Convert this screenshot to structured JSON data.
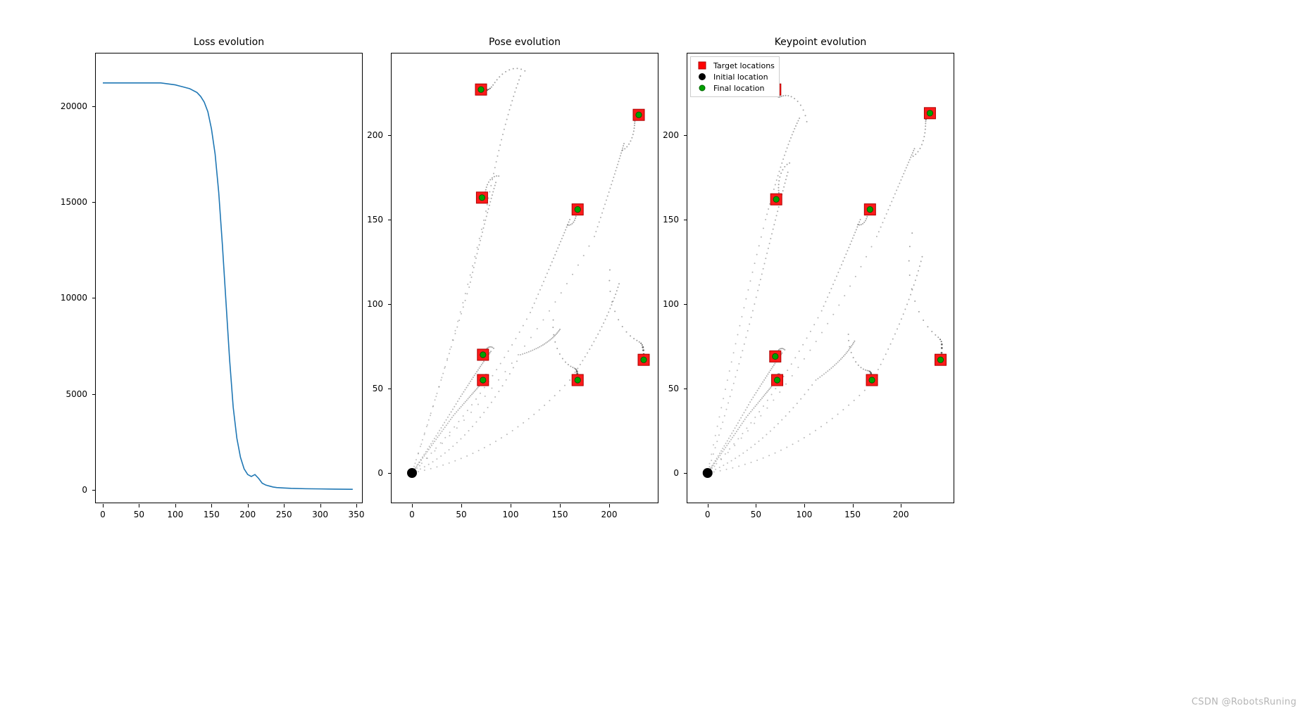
{
  "watermark": "CSDN @RobotsRuning",
  "legend": {
    "target": "Target locations",
    "initial": "Initial location",
    "final": "Final location"
  },
  "chart_data": [
    {
      "type": "line",
      "title": "Loss evolution",
      "xlabel": "",
      "ylabel": "",
      "xlim": [
        0,
        350
      ],
      "ylim": [
        0,
        22000
      ],
      "xticks": [
        0,
        50,
        100,
        150,
        200,
        250,
        300,
        350
      ],
      "yticks": [
        0,
        5000,
        10000,
        15000,
        20000
      ],
      "series": [
        {
          "name": "loss",
          "color": "#1f77b4",
          "x": [
            0,
            10,
            20,
            30,
            40,
            50,
            60,
            70,
            80,
            90,
            100,
            110,
            120,
            130,
            135,
            140,
            145,
            150,
            155,
            160,
            165,
            170,
            175,
            180,
            185,
            190,
            195,
            200,
            205,
            210,
            215,
            220,
            225,
            230,
            235,
            240,
            250,
            260,
            280,
            300,
            320,
            345
          ],
          "y": [
            21200,
            21200,
            21200,
            21200,
            21200,
            21200,
            21200,
            21200,
            21200,
            21150,
            21100,
            21000,
            20900,
            20700,
            20500,
            20200,
            19700,
            18800,
            17500,
            15500,
            12800,
            9800,
            6800,
            4300,
            2700,
            1700,
            1100,
            800,
            700,
            800,
            600,
            350,
            250,
            200,
            150,
            120,
            100,
            80,
            60,
            50,
            40,
            30
          ]
        }
      ]
    },
    {
      "type": "scatter",
      "title": "Pose evolution",
      "xlabel": "",
      "ylabel": "",
      "xlim": [
        -10,
        240
      ],
      "ylim": [
        -10,
        240
      ],
      "xticks": [
        0,
        50,
        100,
        150,
        200
      ],
      "yticks": [
        0,
        50,
        100,
        150,
        200
      ],
      "targets": [
        [
          70,
          227
        ],
        [
          230,
          212
        ],
        [
          71,
          163
        ],
        [
          168,
          156
        ],
        [
          72,
          70
        ],
        [
          72,
          55
        ],
        [
          168,
          55
        ],
        [
          235,
          67
        ]
      ],
      "initial": [
        [
          0,
          0
        ]
      ],
      "finals": [
        [
          70,
          227
        ],
        [
          230,
          212
        ],
        [
          71,
          163
        ],
        [
          168,
          156
        ],
        [
          72,
          70
        ],
        [
          72,
          55
        ],
        [
          168,
          55
        ],
        [
          235,
          67
        ]
      ],
      "trails": [
        {
          "ctrl": [
            45,
            80
          ],
          "mid": [
            75,
            155
          ],
          "swing": [
            110,
            235
          ],
          "swingR": 20,
          "end": [
            70,
            227
          ]
        },
        {
          "ctrl": [
            110,
            60
          ],
          "mid": [
            185,
            140
          ],
          "swing": [
            215,
            195
          ],
          "swingR": 14,
          "end": [
            230,
            212
          ]
        },
        {
          "ctrl": [
            30,
            55
          ],
          "mid": [
            58,
            110
          ],
          "swing": [
            85,
            172
          ],
          "swingR": 15,
          "end": [
            71,
            163
          ]
        },
        {
          "ctrl": [
            70,
            40
          ],
          "mid": [
            120,
            95
          ],
          "swing": [
            160,
            150
          ],
          "swingR": 12,
          "end": [
            168,
            156
          ]
        },
        {
          "ctrl": [
            25,
            22
          ],
          "mid": [
            48,
            44
          ],
          "swing": [
            80,
            72
          ],
          "swingR": 10,
          "end": [
            72,
            70
          ]
        },
        {
          "ctrl": [
            22,
            18
          ],
          "mid": [
            42,
            34
          ],
          "swing": [
            75,
            56
          ],
          "swingR": 8,
          "end": [
            72,
            55
          ]
        },
        {
          "ctrl": [
            60,
            15
          ],
          "mid": [
            110,
            70
          ],
          "swing": [
            150,
            85
          ],
          "swingR": 28,
          "end": [
            168,
            55
          ]
        },
        {
          "ctrl": [
            90,
            10
          ],
          "mid": [
            160,
            55
          ],
          "swing": [
            210,
            112
          ],
          "swingR": 40,
          "end": [
            235,
            67
          ]
        }
      ]
    },
    {
      "type": "scatter",
      "title": "Keypoint evolution",
      "xlabel": "",
      "ylabel": "",
      "xlim": [
        -10,
        245
      ],
      "ylim": [
        -10,
        240
      ],
      "xticks": [
        0,
        50,
        100,
        150,
        200
      ],
      "yticks": [
        0,
        50,
        100,
        150,
        200
      ],
      "legend": true,
      "targets": [
        [
          70,
          227
        ],
        [
          230,
          213
        ],
        [
          71,
          162
        ],
        [
          168,
          156
        ],
        [
          70,
          69
        ],
        [
          72,
          55
        ],
        [
          170,
          55
        ],
        [
          241,
          67
        ]
      ],
      "initial": [
        [
          0,
          0
        ]
      ],
      "finals": [
        [
          70,
          227
        ],
        [
          230,
          213
        ],
        [
          71,
          162
        ],
        [
          168,
          156
        ],
        [
          70,
          69
        ],
        [
          72,
          55
        ],
        [
          170,
          55
        ],
        [
          241,
          67
        ]
      ],
      "trails": [
        {
          "ctrl": [
            28,
            78
          ],
          "mid": [
            60,
            150
          ],
          "swing": [
            95,
            210
          ],
          "swingR": 25,
          "end": [
            70,
            227
          ]
        },
        {
          "ctrl": [
            100,
            55
          ],
          "mid": [
            175,
            140
          ],
          "swing": [
            214,
            192
          ],
          "swingR": 16,
          "end": [
            230,
            213
          ]
        },
        {
          "ctrl": [
            28,
            52
          ],
          "mid": [
            52,
            108
          ],
          "swing": [
            83,
            178
          ],
          "swingR": 18,
          "end": [
            71,
            162
          ]
        },
        {
          "ctrl": [
            65,
            38
          ],
          "mid": [
            118,
            96
          ],
          "swing": [
            158,
            150
          ],
          "swingR": 12,
          "end": [
            168,
            156
          ]
        },
        {
          "ctrl": [
            22,
            20
          ],
          "mid": [
            44,
            42
          ],
          "swing": [
            77,
            71
          ],
          "swingR": 10,
          "end": [
            70,
            69
          ]
        },
        {
          "ctrl": [
            20,
            16
          ],
          "mid": [
            40,
            33
          ],
          "swing": [
            73,
            56
          ],
          "swingR": 8,
          "end": [
            72,
            55
          ]
        },
        {
          "ctrl": [
            58,
            14
          ],
          "mid": [
            112,
            55
          ],
          "swing": [
            152,
            78
          ],
          "swingR": 24,
          "end": [
            170,
            55
          ]
        },
        {
          "ctrl": [
            92,
            8
          ],
          "mid": [
            168,
            52
          ],
          "swing": [
            222,
            128
          ],
          "swingR": 55,
          "end": [
            241,
            67
          ]
        }
      ]
    }
  ]
}
